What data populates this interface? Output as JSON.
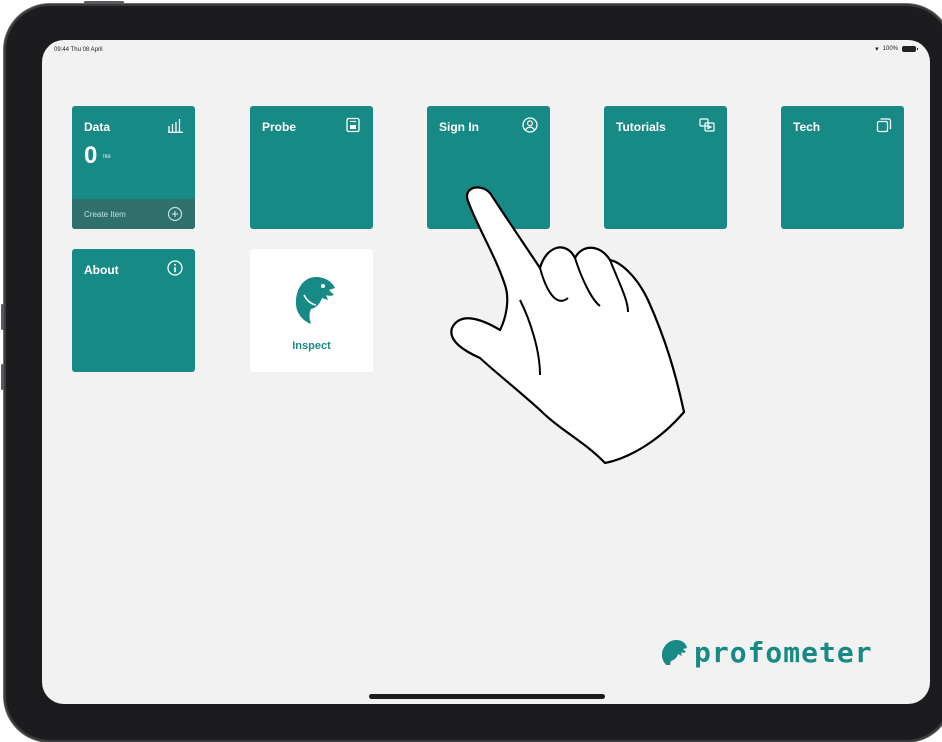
{
  "status_bar": {
    "time": "09:44 Thu 08 April",
    "battery": "100%"
  },
  "tiles": {
    "data": {
      "label": "Data",
      "value": "0",
      "unit": "file",
      "footer": "Create Item",
      "icon": "bar-chart-icon"
    },
    "probe": {
      "label": "Probe",
      "icon": "probe-icon"
    },
    "sign_in": {
      "label": "Sign In",
      "icon": "user-circle-icon"
    },
    "tutorials": {
      "label": "Tutorials",
      "icon": "tutorials-icon"
    },
    "tech": {
      "label": "Tech",
      "icon": "tech-icon"
    },
    "about": {
      "label": "About",
      "icon": "info-icon"
    },
    "inspect": {
      "label": "Inspect",
      "icon": "eagle-logo-icon"
    }
  },
  "brand": {
    "name": "profometer"
  },
  "colors": {
    "tile": "#178a86",
    "tile_footer": "#2f706d",
    "screen_bg": "#f2f2f2",
    "device_frame": "#1c1c1e"
  }
}
